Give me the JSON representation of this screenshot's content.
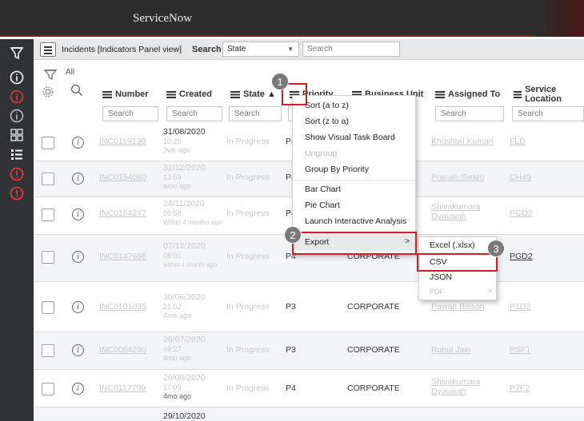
{
  "app": {
    "brand": "ServiceNow"
  },
  "list_header": {
    "title": "Incidents [Indicators Panel view]",
    "search_label": "Search",
    "search_field": "State",
    "search_placeholder": "Search"
  },
  "breadcrumb": {
    "all": "All"
  },
  "columns": [
    {
      "label": "Number"
    },
    {
      "label": "Created"
    },
    {
      "label": "State ▲"
    },
    {
      "label": "Priority"
    },
    {
      "label": "Business Unit"
    },
    {
      "label": "Assigned To"
    },
    {
      "label": "Service Location"
    }
  ],
  "column_search_placeholder": "Search",
  "rows": [
    {
      "number": "INC0119139",
      "created": "31/08/2020",
      "time": "10:20",
      "ago": "3wk ago",
      "state": "In Progress",
      "priority": "P4",
      "business_unit": "",
      "assigned_to": "Khushbu Kumari",
      "location": "FLD"
    },
    {
      "number": "INC0154080",
      "created": "31/12/2020",
      "time": "13:59",
      "ago": "4mo ago",
      "state": "In Progress",
      "priority": "P4",
      "business_unit": "",
      "assigned_to": "Pranab Swaro",
      "location": "CH49"
    },
    {
      "number": "INC0164247",
      "created": "24/11/2020",
      "time": "05:58",
      "ago": "Within 4 months ago",
      "state": "In Progress",
      "priority": "P4",
      "business_unit": "",
      "assigned_to": "Shivakumara Dyavaiah",
      "location": "PGD2"
    },
    {
      "number": "INC0147696",
      "created": "07/12/2020",
      "time": "08:01",
      "ago": "within 4 month ago",
      "state": "In Progress",
      "priority": "P4",
      "business_unit": "CORPORATE",
      "assigned_to": "",
      "location": "PGD2"
    },
    {
      "number": "INC0101035",
      "created": "30/06/2020",
      "time": "21:02",
      "ago": "4mo ago",
      "state": "In Progress",
      "priority": "P3",
      "business_unit": "CORPORATE",
      "assigned_to": "Pawan Bisson",
      "location": "P1D2"
    },
    {
      "number": "INC0084290",
      "created": "28/07/2020",
      "time": "09:27",
      "ago": "4mo ago",
      "state": "In Progress",
      "priority": "P3",
      "business_unit": "CORPORATE",
      "assigned_to": "Rahul Jain",
      "location": "PSF1"
    },
    {
      "number": "INC0117799",
      "created": "26/08/2020",
      "time": "17:09",
      "ago": "4mo ago",
      "state": "In Progress",
      "priority": "P4",
      "business_unit": "CORPORATE",
      "assigned_to": "Shivakumara Dyavaiah",
      "location": "P7F2"
    },
    {
      "number": "",
      "created": "29/10/2020",
      "time": "",
      "ago": "",
      "state": "",
      "priority": "",
      "business_unit": "",
      "assigned_to": "",
      "location": ""
    }
  ],
  "context_menu": {
    "sort_az": "Sort (a to z)",
    "sort_za": "Sort (z to a)",
    "visual_task_board": "Show Visual Task Board",
    "ungroup": "Ungroup",
    "group_by": "Group By Priority",
    "bar_chart": "Bar Chart",
    "pie_chart": "Pie Chart",
    "interactive_analysis": "Launch Interactive Analysis",
    "export": "Export",
    "export_arrow": ">"
  },
  "export_submenu": {
    "excel": "Excel (.xlsx)",
    "csv": "CSV",
    "json": "JSON",
    "pdf": "PDF",
    "pdf_arrow": ">"
  },
  "callouts": {
    "one": "1",
    "two": "2",
    "three": "3"
  },
  "colors": {
    "highlight": "#d01c24",
    "nav_bg": "#2f3336",
    "header_bg": "#e6e8ea",
    "alert_icon": "#e0393e"
  }
}
